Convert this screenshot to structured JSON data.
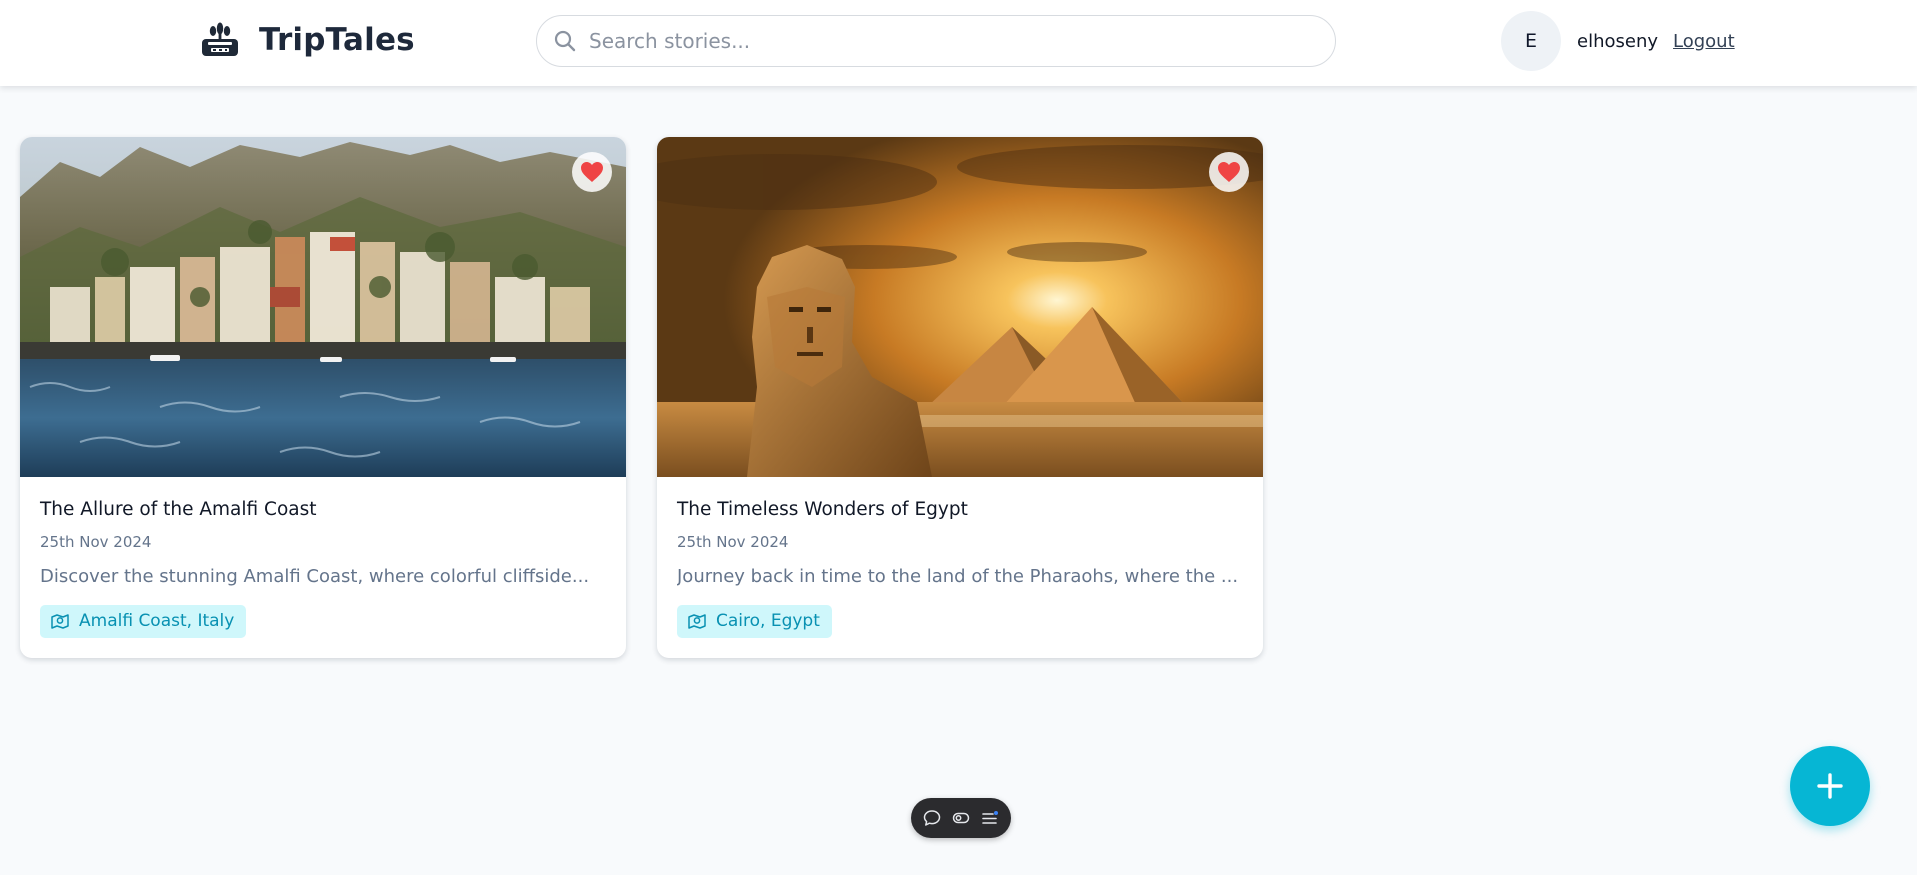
{
  "header": {
    "brand_name": "TripTales",
    "logo_icon": "travel-logo-icon",
    "search": {
      "placeholder": "Search stories...",
      "value": ""
    },
    "user": {
      "avatar_initial": "E",
      "username": "elhoseny",
      "logout_label": "Logout"
    }
  },
  "stories": [
    {
      "title": "The Allure of the Amalfi Coast",
      "date": "25th Nov 2024",
      "excerpt": "Discover the stunning Amalfi Coast, where colorful cliffside...",
      "location": "Amalfi Coast, Italy",
      "favorited": true,
      "image": "amalfi-coast-photo"
    },
    {
      "title": "The Timeless Wonders of Egypt",
      "date": "25th Nov 2024",
      "excerpt": "Journey back in time to the land of the Pharaohs, where the ...",
      "location": "Cairo, Egypt",
      "favorited": true,
      "image": "sphinx-pyramids-photo"
    }
  ],
  "fab": {
    "icon": "plus-icon"
  },
  "toolbar": {
    "icons": [
      "chat-icon",
      "toggle-icon",
      "list-icon"
    ]
  },
  "colors": {
    "accent": "#06b6d4",
    "tag_bg": "#cff7fb",
    "tag_text": "#0891b2",
    "heart": "#ef4444",
    "page_bg": "#f8fafc"
  }
}
